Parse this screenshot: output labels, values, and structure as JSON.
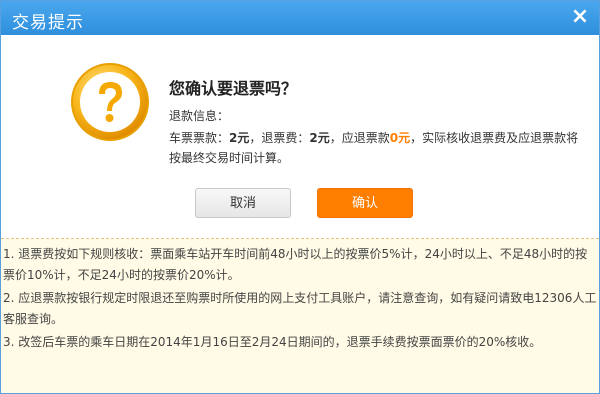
{
  "dialog": {
    "title": "交易提示",
    "close_label": "×"
  },
  "message": {
    "question": "您确认要退票吗？",
    "info_label": "退款信息：",
    "ticket_refund_label": "车票票款：",
    "ticket_refund_value": "2元",
    "fee_label": "，退票费：",
    "fee_value": "2元",
    "due_label": "，应退票款",
    "due_value": "0元",
    "tail": "，实际核收退票费及应退票款将按最终交易时间计算。"
  },
  "buttons": {
    "cancel_label": "取消",
    "confirm_label": "确认"
  },
  "rules": [
    "1. 退票费按如下规则核收：票面乘车站开车时间前48小时以上的按票价5%计，24小时以上、不足48小时的按票价10%计，不足24小时的按票价20%计。",
    "2. 应退票款按银行规定时限退还至购票时所使用的网上支付工具账户，请注意查询，如有疑问请致电12306人工客服查询。",
    "3. 改签后车票的乘车日期在2014年1月16日至2月24日期间的，退票手续费按票面票价的20%核收。"
  ],
  "colors": {
    "titlebar": "#2f8fdc",
    "confirm_button": "#ff7e00",
    "highlight": "#ff7f00",
    "rules_background": "#fffbe6"
  },
  "icons": {
    "dialog_icon": "question-mark-icon",
    "close": "close-icon"
  }
}
